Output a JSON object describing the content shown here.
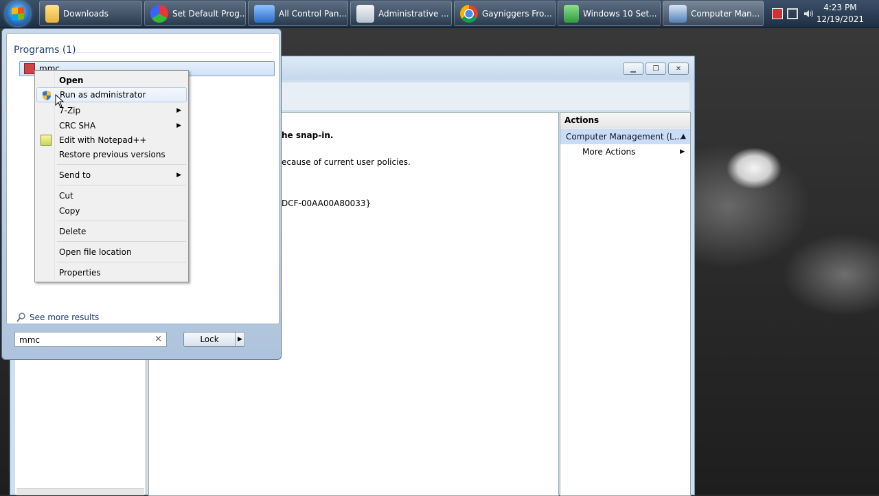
{
  "taskbar": {
    "items": [
      {
        "label": "Downloads",
        "icon": "folder-icon"
      },
      {
        "label": "Set Default Prog...",
        "icon": "default-programs-icon"
      },
      {
        "label": "All Control Pan...",
        "icon": "control-panel-icon"
      },
      {
        "label": "Administrative ...",
        "icon": "admin-tools-icon"
      },
      {
        "label": "Gayniggers Fro...",
        "icon": "chrome-icon"
      },
      {
        "label": "Windows 10 Set...",
        "icon": "setup-icon"
      },
      {
        "label": "Computer Man...",
        "icon": "computer-management-icon"
      }
    ],
    "clock": {
      "time": "4:23 PM",
      "date": "12/19/2021"
    }
  },
  "start_menu": {
    "section_header": "Programs (1)",
    "result": {
      "label": "mmc",
      "icon": "mmc-icon"
    },
    "see_more": "See more results",
    "search": {
      "value": "mmc"
    },
    "lock_label": "Lock"
  },
  "context_menu": {
    "items": [
      {
        "label": "Open",
        "bold": true
      },
      {
        "label": "Run as administrator",
        "icon": "uac-shield-icon",
        "highlighted": true
      },
      {
        "label": "7-Zip",
        "submenu": true
      },
      {
        "label": "CRC SHA",
        "submenu": true
      },
      {
        "label": "Edit with Notepad++",
        "icon": "notepadpp-icon"
      },
      {
        "label": "Restore previous versions"
      },
      {
        "label": "Send to",
        "submenu": true
      },
      {
        "label": "Cut"
      },
      {
        "label": "Copy"
      },
      {
        "label": "Delete"
      },
      {
        "label": "Open file location"
      },
      {
        "label": "Properties"
      }
    ]
  },
  "mmc_window": {
    "center_lines": [
      "he snap-in.",
      "ecause of current user policies.",
      "DCF-00AA00A80033}"
    ],
    "actions": {
      "header": "Actions",
      "selected": "Computer Management (L...",
      "more_actions": "More Actions"
    }
  }
}
